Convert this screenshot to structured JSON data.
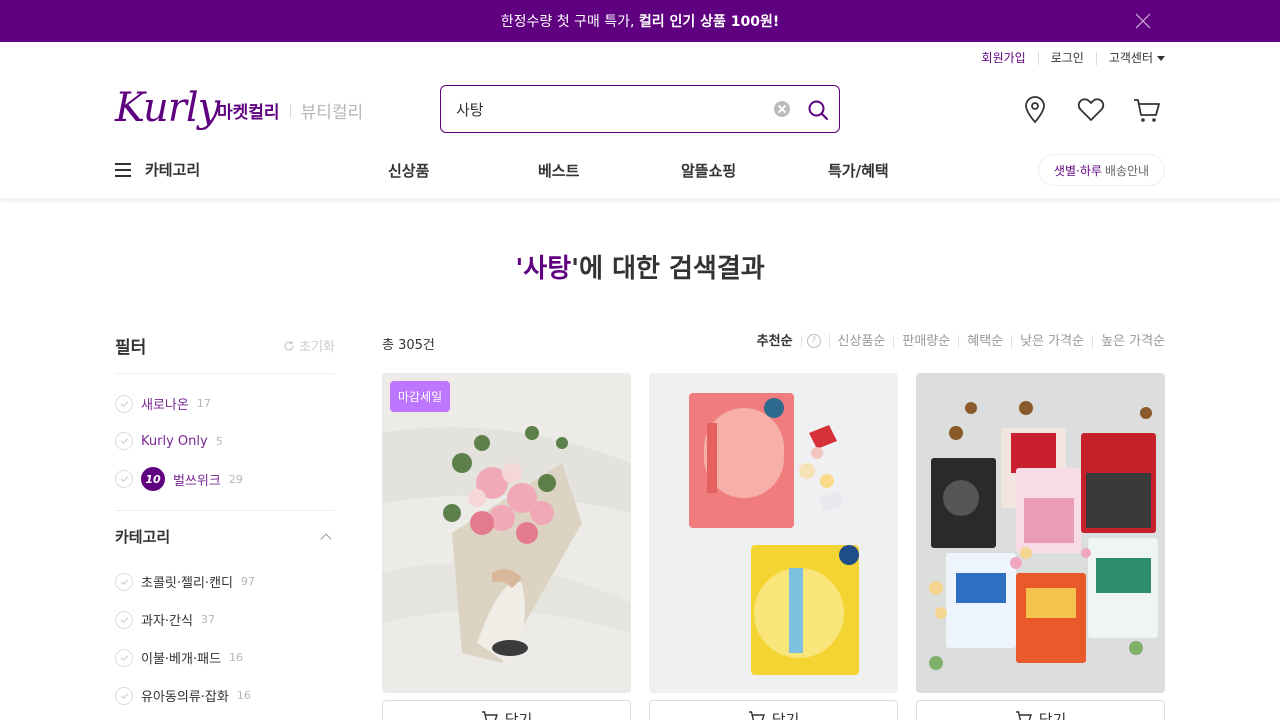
{
  "banner": {
    "text_prefix": "한정수량 첫 구매 특가, ",
    "text_bold": "컬리 인기 상품 100원!"
  },
  "utility": {
    "signup": "회원가입",
    "login": "로그인",
    "support": "고객센터"
  },
  "brand": {
    "logo_text": "Kurly",
    "tab_market": "마켓컬리",
    "tab_beauty": "뷰티컬리",
    "accent": "#5f0080"
  },
  "search": {
    "value": "사탕"
  },
  "gnb": {
    "category": "카테고리",
    "menus": [
      "신상품",
      "베스트",
      "알뜰쇼핑",
      "특가/혜택"
    ],
    "delivery_highlight": "샛별·하루",
    "delivery_text": "배송안내"
  },
  "result": {
    "quote_open": "'",
    "keyword": "사탕",
    "quote_close": "'",
    "suffix": "에 대한 검색결과"
  },
  "filter": {
    "title": "필터",
    "reset": "초기화",
    "badges": [
      {
        "label": "새로나온",
        "count": "17"
      },
      {
        "label": "Kurly Only",
        "count": "5"
      },
      {
        "icon_text": "10",
        "label": "벌쓰위크",
        "count": "29"
      }
    ],
    "category_title": "카테고리",
    "categories": [
      {
        "label": "초콜릿·젤리·캔디",
        "count": "97"
      },
      {
        "label": "과자·간식",
        "count": "37"
      },
      {
        "label": "이불·베개·패드",
        "count": "16"
      },
      {
        "label": "유아동의류·잡화",
        "count": "16"
      }
    ]
  },
  "listing": {
    "total": "총 305건",
    "sort_options": [
      "추천순",
      "신상품순",
      "판매량순",
      "혜택순",
      "낮은 가격순",
      "높은 가격순"
    ],
    "products": [
      {
        "badge": "마감세일",
        "cart_label": "담기"
      },
      {
        "cart_label": "담기"
      },
      {
        "cart_label": "담기"
      }
    ]
  }
}
